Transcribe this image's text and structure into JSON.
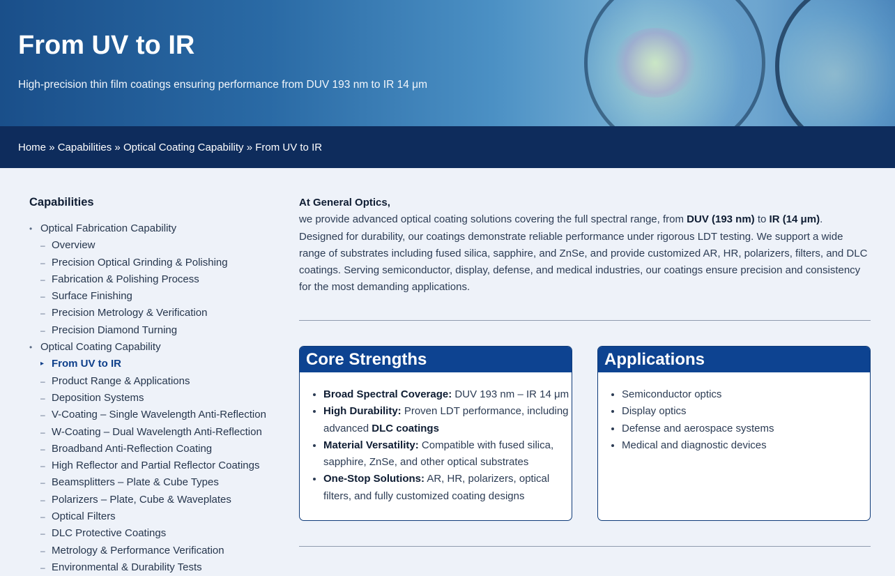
{
  "hero": {
    "title": "From UV to IR",
    "subtitle": "High-precision thin film coatings ensuring performance from DUV 193 nm to IR 14 μm"
  },
  "breadcrumb": {
    "items": [
      "Home",
      "Capabilities",
      "Optical Coating Capability",
      "From UV to IR"
    ],
    "separator": "»"
  },
  "sidebar": {
    "title": "Capabilities",
    "bullet": "•",
    "dash": "–",
    "active_marker": "▸",
    "items": [
      {
        "label": "Optical Fabrication Capability",
        "level": 1
      },
      {
        "label": "Overview",
        "level": 2
      },
      {
        "label": "Precision Optical Grinding & Polishing",
        "level": 2
      },
      {
        "label": "Fabrication & Polishing Process",
        "level": 2
      },
      {
        "label": "Surface Finishing",
        "level": 2
      },
      {
        "label": "Precision Metrology & Verification",
        "level": 2
      },
      {
        "label": "Precision Diamond Turning",
        "level": 2
      },
      {
        "label": "Optical Coating Capability",
        "level": 1
      },
      {
        "label": "From UV to IR",
        "level": 2,
        "active": true
      },
      {
        "label": "Product Range & Applications",
        "level": 2
      },
      {
        "label": "Deposition Systems",
        "level": 2
      },
      {
        "label": "V-Coating – Single Wavelength Anti-Reflection",
        "level": 2
      },
      {
        "label": "W-Coating – Dual Wavelength Anti-Reflection",
        "level": 2
      },
      {
        "label": "Broadband Anti-Reflection Coating",
        "level": 2
      },
      {
        "label": "High Reflector and Partial Reflector Coatings",
        "level": 2
      },
      {
        "label": "Beamsplitters – Plate & Cube Types",
        "level": 2
      },
      {
        "label": "Polarizers – Plate, Cube & Waveplates",
        "level": 2
      },
      {
        "label": "Optical Filters",
        "level": 2
      },
      {
        "label": "DLC Protective Coatings",
        "level": 2
      },
      {
        "label": "Metrology & Performance Verification",
        "level": 2
      },
      {
        "label": "Environmental & Durability Tests",
        "level": 2
      }
    ]
  },
  "intro": {
    "heading": "At General Optics,",
    "p1": "we provide advanced optical coating solutions covering the full spectral range, from ",
    "duv": "DUV (193 nm)",
    "p2": " to ",
    "ir": "IR (14 μm)",
    "p3": ".",
    "body": "Designed for durability, our coatings demonstrate reliable performance under rigorous LDT testing. We support a wide range of substrates including fused silica, sapphire, and ZnSe, and provide customized AR, HR, polarizers, filters, and DLC coatings. Serving semiconductor, display, defense, and medical industries, our coatings ensure precision and consistency for the most demanding applications."
  },
  "core_strengths": {
    "title": "Core Strengths",
    "items": [
      {
        "bold": "Broad Spectral Coverage:",
        "text": " DUV 193 nm – IR 14 μm"
      },
      {
        "bold": "High Durability:",
        "text": " Proven LDT performance, including advanced ",
        "bold2": "DLC coatings"
      },
      {
        "bold": "Material Versatility:",
        "text": " Compatible with fused silica, sapphire, ZnSe, and other optical substrates"
      },
      {
        "bold": "One-Stop Solutions:",
        "text": " AR, HR, polarizers, optical filters, and fully customized coating designs"
      }
    ]
  },
  "applications": {
    "title": "Applications",
    "items": [
      "Semiconductor optics",
      "Display optics",
      "Defense and aerospace systems",
      "Medical and diagnostic devices"
    ]
  },
  "colors": {
    "breadcrumb_bg": "#0e2c5c",
    "card_header": "#0d4391",
    "page_bg": "#eef2f9",
    "active_link": "#0e3f8a"
  }
}
